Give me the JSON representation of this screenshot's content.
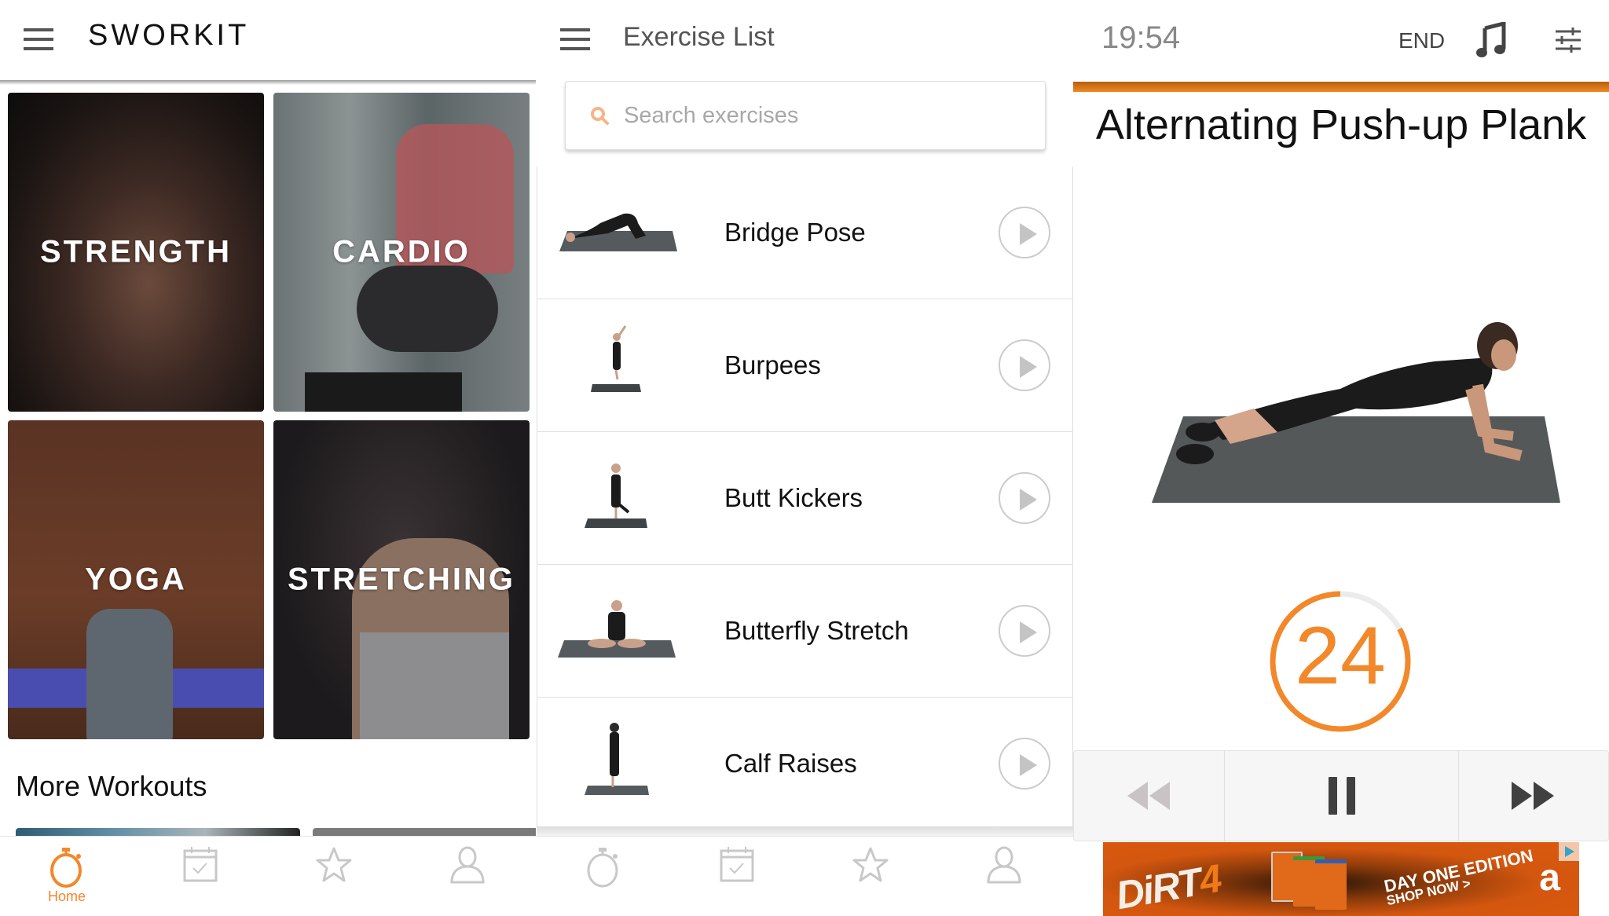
{
  "home": {
    "brand": "SWORKIT",
    "tiles": [
      {
        "label": "STRENGTH"
      },
      {
        "label": "CARDIO"
      },
      {
        "label": "YOGA"
      },
      {
        "label": "STRETCHING"
      }
    ],
    "more_workouts_title": "More Workouts",
    "tabbar": [
      {
        "icon": "stopwatch-icon",
        "label": "Home",
        "active": true
      },
      {
        "icon": "calendar-check-icon",
        "label": "",
        "active": false
      },
      {
        "icon": "star-icon",
        "label": "",
        "active": false
      },
      {
        "icon": "user-icon",
        "label": "",
        "active": false
      }
    ]
  },
  "exercise_list": {
    "title": "Exercise List",
    "search": {
      "placeholder": "Search exercises",
      "value": ""
    },
    "items": [
      {
        "name": "Bridge Pose"
      },
      {
        "name": "Burpees"
      },
      {
        "name": "Butt Kickers"
      },
      {
        "name": "Butterfly Stretch"
      },
      {
        "name": "Calf Raises"
      }
    ],
    "tabbar": [
      {
        "icon": "stopwatch-icon"
      },
      {
        "icon": "calendar-check-icon"
      },
      {
        "icon": "star-icon"
      },
      {
        "icon": "user-icon"
      }
    ]
  },
  "player": {
    "time_remaining": "19:54",
    "end_label": "END",
    "workout_progress_percent": 1,
    "exercise_title": "Alternating Push-up Plank",
    "countdown": "24",
    "countdown_fraction_remaining": 0.83,
    "controls": [
      "previous",
      "pause",
      "next"
    ],
    "ad": {
      "brand": "DiRT",
      "brand_number": "4",
      "headline": "DAY ONE EDITION",
      "cta": "SHOP NOW >",
      "retailer": "a"
    }
  },
  "colors": {
    "accent": "#f2882a",
    "icon_inactive": "#c8c8c8",
    "text_dark": "#111111"
  }
}
